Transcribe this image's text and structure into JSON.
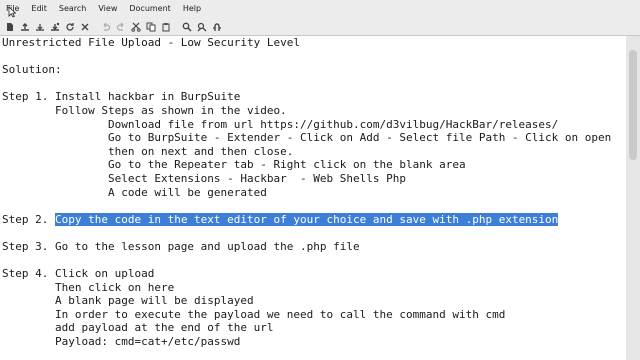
{
  "menu": {
    "items": [
      "File",
      "Edit",
      "Search",
      "View",
      "Document",
      "Help"
    ]
  },
  "toolbar": {
    "icons": [
      "new-file-icon",
      "open-file-icon",
      "save-icon",
      "save-as-icon",
      "reload-icon",
      "close-icon",
      "undo-icon",
      "redo-icon",
      "cut-icon",
      "copy-icon",
      "paste-icon",
      "find-icon",
      "find-replace-icon",
      "goto-line-icon"
    ]
  },
  "document": {
    "lines": [
      "Unrestricted File Upload - Low Security Level",
      "",
      "Solution:",
      "",
      "Step 1. Install hackbar in BurpSuite",
      "        Follow Steps as shown in the video.",
      "                Download file from url https://github.com/d3vilbug/HackBar/releases/",
      "                Go to BurpSuite - Extender - Click on Add - Select file Path - Click on open",
      "                then on next and then close.",
      "                Go to the Repeater tab - Right click on the blank area",
      "                Select Extensions - Hackbar  - Web Shells Php",
      "                A code will be generated",
      "",
      "Step 2. ",
      "",
      "Step 3. Go to the lesson page and upload the .php file",
      "",
      "Step 4. Click on upload",
      "        Then click on here",
      "        A blank page will be displayed",
      "        In order to execute the payload we need to call the command with cmd",
      "        add payload at the end of the url",
      "        Payload: cmd=cat+/etc/passwd"
    ],
    "selected_text": "Copy the code in the text editor of your choice and save with .php extension"
  }
}
